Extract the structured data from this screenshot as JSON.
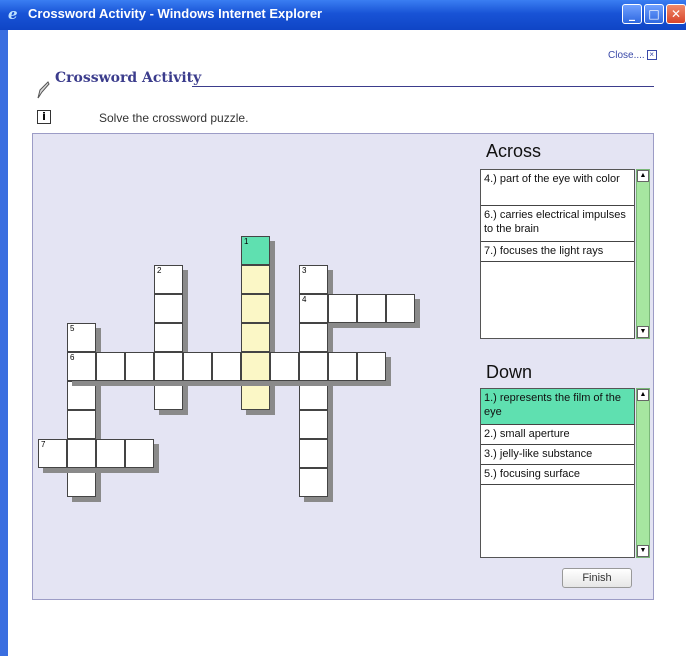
{
  "window": {
    "title": "Crossword Activity - Windows Internet Explorer"
  },
  "close_link": "Close",
  "header": {
    "title": "Crossword Activity"
  },
  "instruction": "Solve the crossword puzzle.",
  "across": {
    "title": "Across",
    "clues": [
      {
        "text": "4.) part of the eye with color"
      },
      {
        "text": "6.) carries electrical impulses to the brain"
      },
      {
        "text": "7.) focuses the light rays"
      }
    ]
  },
  "down": {
    "title": "Down",
    "clues": [
      {
        "text": "1.) represents the film of the eye"
      },
      {
        "text": "2.) small aperture"
      },
      {
        "text": "3.) jelly-like substance"
      },
      {
        "text": "5.) focusing surface"
      }
    ]
  },
  "finish_label": "Finish",
  "grid_numbers": {
    "n1": "1",
    "n2": "2",
    "n3": "3",
    "n4": "4",
    "n5": "5",
    "n6": "6",
    "n7": "7"
  },
  "colors": {
    "active_cell": "#5fe0b0",
    "highlight_word": "#fbf7c6",
    "panel": "#e4e4f3"
  }
}
